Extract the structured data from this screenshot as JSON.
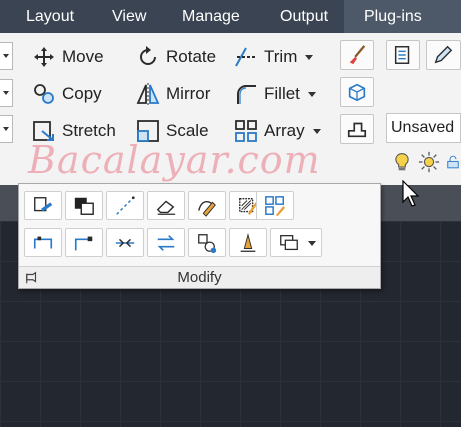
{
  "menu": {
    "items": [
      "Layout",
      "View",
      "Manage",
      "Output",
      "Plug-ins"
    ],
    "active_index": 4
  },
  "modify_tools": {
    "row1": [
      {
        "label": "Move",
        "icon": "move-icon"
      },
      {
        "label": "Rotate",
        "icon": "rotate-icon"
      },
      {
        "label": "Trim",
        "icon": "trim-icon",
        "dropdown": true
      }
    ],
    "row2": [
      {
        "label": "Copy",
        "icon": "copy-icon"
      },
      {
        "label": "Mirror",
        "icon": "mirror-icon"
      },
      {
        "label": "Fillet",
        "icon": "fillet-icon",
        "dropdown": true
      }
    ],
    "row3": [
      {
        "label": "Stretch",
        "icon": "stretch-icon"
      },
      {
        "label": "Scale",
        "icon": "scale-icon"
      },
      {
        "label": "Array",
        "icon": "array-icon",
        "dropdown": true
      }
    ]
  },
  "right_panel": {
    "layer_state": "Unsaved"
  },
  "expanded_panel": {
    "title": "Modify",
    "row1_icons": [
      "copy-properties-icon",
      "draworder-icon",
      "break-line-icon",
      "erase-icon",
      "edit-pline-icon",
      "edit-hatch-icon",
      "edit-array-icon"
    ],
    "row2_icons": [
      "lengthen-icon",
      "align-icon",
      "join-icon",
      "reverse-icon",
      "set-by-layer-icon",
      "edit-spline-icon",
      "overkill-icon"
    ]
  },
  "watermark": "Bacalayar.com",
  "colors": {
    "menubar": "#3b4452",
    "ribbon": "#f3f3f3",
    "workspace": "#232830",
    "accent_blue": "#2a7ac8"
  }
}
